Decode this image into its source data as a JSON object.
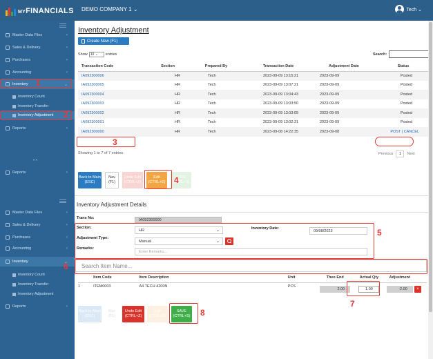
{
  "topbar": {
    "brand_prefix": "MY",
    "brand": "FINANCIALS",
    "company": "DEMO COMPANY 1 ⌄",
    "user": "Tech ⌄",
    "colors": {
      "bar": "#2c5f8a",
      "logo": [
        "#f5b400",
        "#e53935",
        "#43a047",
        "#1e88e5"
      ]
    }
  },
  "sidebar": {
    "top_menu": [
      {
        "label": "Master Data Files",
        "icon": "gear-icon"
      },
      {
        "label": "Sales & Delivery",
        "icon": "tag-icon"
      },
      {
        "label": "Purchases",
        "icon": "cart-icon"
      },
      {
        "label": "Accounting",
        "icon": "calculator-icon"
      },
      {
        "label": "Inventory",
        "icon": "boxes-icon"
      },
      {
        "label": "Inventory Count",
        "icon": "list-icon"
      },
      {
        "label": "Inventory Transfer",
        "icon": "list-icon"
      },
      {
        "label": "Inventory Adjustment",
        "icon": "list-icon"
      },
      {
        "label": "Reports",
        "icon": "chart-icon"
      }
    ],
    "mid_reports": "Reports",
    "dots": "•   •",
    "bottom_menu": [
      {
        "label": "Master Data Files"
      },
      {
        "label": "Sales & Delivery"
      },
      {
        "label": "Purchases"
      },
      {
        "label": "Accounting"
      },
      {
        "label": "Inventory"
      },
      {
        "label": "Inventory Count"
      },
      {
        "label": "Inventory Transfer"
      },
      {
        "label": "Inventory Adjustment"
      },
      {
        "label": "Reports"
      }
    ]
  },
  "annotations": [
    "1",
    "2",
    "3",
    "4",
    "5",
    "6",
    "7",
    "8"
  ],
  "main": {
    "title": "Inventory Adjustment",
    "create_button": "Create New (F1)",
    "show_prefix": "Show",
    "show_value": "10",
    "show_suffix": "entries",
    "search_label": "Search:",
    "columns": [
      "Transaction Code",
      "Section",
      "Prepared By",
      "Transaction Date",
      "Adjustment Date",
      "Status"
    ],
    "rows": [
      [
        "IA092300006",
        "HR",
        "Tech",
        "2023-09-09 13:15:21",
        "2023-09-09",
        "Posted"
      ],
      [
        "IA092300005",
        "HR",
        "Tech",
        "2023-09-09 13:07:21",
        "2023-09-09",
        "Posted"
      ],
      [
        "IA092300004",
        "HR",
        "Tech",
        "2023-09-09 13:04:43",
        "2023-09-09",
        "Posted"
      ],
      [
        "IA092300003",
        "HR",
        "Tech",
        "2023-09-09 13:03:50",
        "2023-09-09",
        "Posted"
      ],
      [
        "IA092300002",
        "HR",
        "Tech",
        "2023-09-09 13:03:09",
        "2023-09-09",
        "Posted"
      ],
      [
        "IA092300001",
        "HR",
        "Tech",
        "2023-09-09 13:02:31",
        "2023-09-09",
        "Posted"
      ],
      [
        "IA092300000",
        "HR",
        "Tech",
        "2023-09-08 14:22:35",
        "2023-09-08",
        "POST | CANCEL"
      ]
    ],
    "table_info": "Showing 1 to 7 of 7 entries",
    "pager": {
      "prev": "Previous",
      "page": "1",
      "next": "Next"
    },
    "buttons": {
      "back_main": "Back to Main",
      "back_main_key": "(ESC)",
      "nav": "Nav",
      "nav_key": "(F1)",
      "undo_faint": "Undo Edit",
      "undo_faint_key": "(CTRL+Z)",
      "edit": "Edit",
      "edit_key": "(CTRL+E)",
      "save_faint": "SAVE",
      "save_faint_key": "(CTRL+S)"
    },
    "details_title": "Inventory Adjustment Details",
    "form": {
      "trans_no_label": "Trans No:",
      "trans_no": "IA092300000",
      "section_label": "Section:",
      "section": "HR",
      "inv_date_label": "Inventory Date:",
      "inv_date": "09/08/2023",
      "adj_type_label": "Adjustment Type:",
      "adj_type": "Manual",
      "remarks_label": "Remarks:",
      "remarks_placeholder": "Enter Remarks..."
    },
    "search_item_placeholder": "Search Item Name...",
    "item_columns": [
      "Item Code",
      "Item Description",
      "Unit",
      "Theo End",
      "Actual Qty",
      "Adjustment"
    ],
    "items": [
      {
        "no": "1",
        "code": "ITEM0003",
        "desc": "A4 TECH 4200N",
        "unit": "PCS",
        "theo": "2.00",
        "actual": "1.00",
        "adj": "-2.00",
        "del": "×"
      }
    ],
    "bottom_buttons": {
      "back_main": "Back to Main",
      "back_main_key": "(ESC)",
      "nav": "Nav",
      "nav_key": "(F1)",
      "undo": "Undo Edit",
      "undo_key": "(CTRL+Z)",
      "edit_faint": "Edit",
      "edit_faint_key": "(CTRL+E)",
      "save": "SAVE",
      "save_key": "(CTRL+S)"
    }
  }
}
